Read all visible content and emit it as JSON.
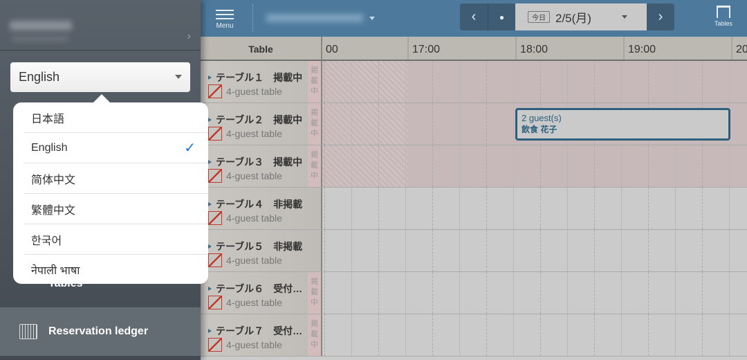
{
  "sidebar": {
    "language_select": {
      "value": "English"
    },
    "languages": [
      {
        "label": "日本語",
        "selected": false
      },
      {
        "label": "English",
        "selected": true
      },
      {
        "label": "简体中文",
        "selected": false
      },
      {
        "label": "繁體中文",
        "selected": false
      },
      {
        "label": "한국어",
        "selected": false
      },
      {
        "label": "नेपाली भाषा",
        "selected": false
      }
    ],
    "nav": {
      "tables": "Tables",
      "reservation_ledger": "Reservation ledger"
    }
  },
  "header": {
    "menu_label": "Menu",
    "today_label": "今日",
    "date": "2/5(月)",
    "tables_label": "Tables"
  },
  "timeline": {
    "table_header": "Table",
    "hours": [
      "00",
      "17:00",
      "18:00",
      "19:00",
      "20"
    ],
    "rows": [
      {
        "name": "テーブル１　掲載中",
        "capacity": "4-guest table",
        "badge": "掲載中",
        "blocked": true
      },
      {
        "name": "テーブル２　掲載中",
        "capacity": "4-guest table",
        "badge": "掲載中",
        "blocked": true
      },
      {
        "name": "テーブル３　掲載中",
        "capacity": "4-guest table",
        "badge": "掲載中",
        "blocked": true
      },
      {
        "name": "テーブル４　非掲載",
        "capacity": "4-guest table",
        "badge": "",
        "blocked": false
      },
      {
        "name": "テーブル５　非掲載",
        "capacity": "4-guest table",
        "badge": "",
        "blocked": false
      },
      {
        "name": "テーブル６　受付…",
        "capacity": "4-guest table",
        "badge": "掲載中",
        "blocked": false
      },
      {
        "name": "テーブル７　受付…",
        "capacity": "4-guest table",
        "badge": "掲載中",
        "blocked": false
      }
    ],
    "reservation": {
      "guests": "2 guest(s)",
      "name": "飲食 花子",
      "start": "18:00",
      "end": "20:00"
    }
  },
  "colors": {
    "header": "#4d7a9c",
    "accent": "#2d5f7c",
    "check": "#1a73e8"
  }
}
